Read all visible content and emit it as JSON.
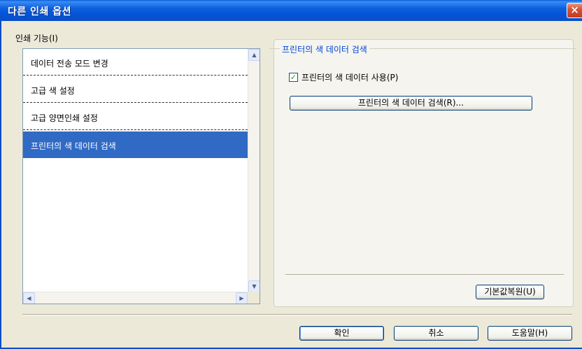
{
  "window": {
    "title": "다른 인쇄 옵션",
    "close_icon": "×"
  },
  "features": {
    "label": "인쇄 기능(I)",
    "items": [
      {
        "label": "데이터 전송 모드 변경"
      },
      {
        "label": "고급 색 설정"
      },
      {
        "label": "고급 양면인쇄 설정"
      },
      {
        "label": "프린터의 색 데이터 검색"
      }
    ],
    "selected_index": 3
  },
  "scroll": {
    "up": "▲",
    "down": "▼",
    "left": "◀",
    "right": "▶"
  },
  "panel": {
    "group_title": "프린터의 색 데이터 검색",
    "checkbox_label": "프린터의 색 데이터 사용(P)",
    "checkbox_checked": true,
    "checkmark": "✓",
    "retrieve_button": "프린터의 색 데이터 검색(R)...",
    "default_button": "기본값복원(U)"
  },
  "footer": {
    "ok": "확인",
    "cancel": "취소",
    "help": "도움말(H)"
  }
}
